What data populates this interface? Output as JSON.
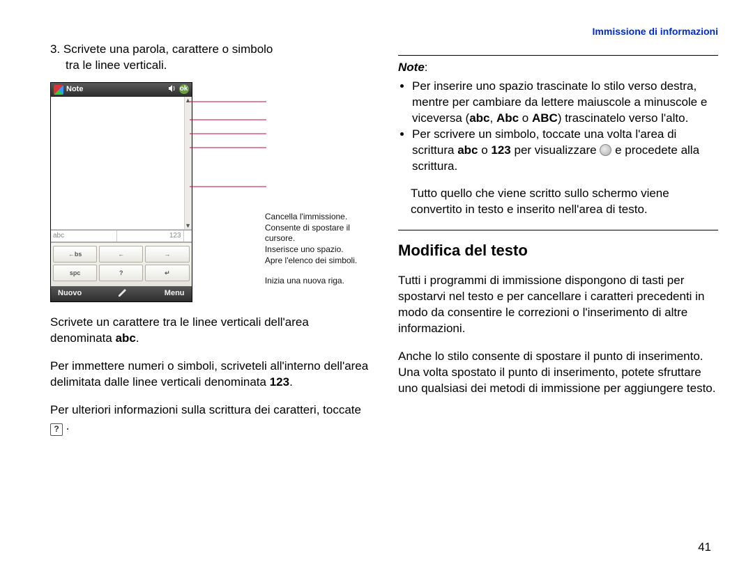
{
  "header": {
    "section_label": "Immissione di informazioni"
  },
  "screenshot": {
    "app_title": "Note",
    "ok_label": "ok",
    "strip_abc": "abc",
    "strip_123": "123",
    "buttons": {
      "bs": "←bs",
      "left": "←",
      "right": "→",
      "spc": "spc",
      "q": "?",
      "enter": "↵"
    },
    "bottom_left": "Nuovo",
    "bottom_right": "Menu"
  },
  "callouts": {
    "c1": "Cancella l'immissione.",
    "c2": "Consente di spostare il cursore.",
    "c3": "Inserisce uno spazio.",
    "c4": "Apre l'elenco dei simboli.",
    "c5": "Inizia una nuova riga."
  },
  "left": {
    "step3_a": "3. Scrivete una parola, carattere o simbolo",
    "step3_b": "tra le linee verticali.",
    "p1_a": "Scrivete un carattere tra le linee verticali dell'area denominata ",
    "p1_b": "abc",
    "p1_c": ".",
    "p2_a": "Per immettere numeri o simboli, scriveteli all'interno dell'area delimitata dalle linee verticali denominata ",
    "p2_b": "123",
    "p2_c": ".",
    "p3_a": "Per ulteriori informazioni sulla scrittura dei caratteri, toccate ",
    "p3_b": " ."
  },
  "right": {
    "note_label": "Note",
    "colon": ":",
    "li1_a": "Per inserire uno spazio trascinate lo stilo verso destra, mentre per cambiare da lettere maiuscole a minuscole e viceversa (",
    "li1_b": "abc",
    "li1_c": ", ",
    "li1_d": "Abc",
    "li1_e": " o ",
    "li1_f": "ABC",
    "li1_g": ") trascinatelo verso l'alto.",
    "li2_a": "Per scrivere un simbolo, toccate una volta l'area di scrittura ",
    "li2_b": "abc",
    "li2_c": " o ",
    "li2_d": "123",
    "li2_e": " per visualizzare ",
    "li2_f": " e procedete alla scrittura.",
    "after_note": "Tutto quello che viene scritto sullo schermo viene convertito in testo e inserito nell'area di testo.",
    "heading": "Modifica del testo",
    "h_p1": "Tutti i programmi di immissione dispongono di tasti per spostarvi nel testo e per cancellare i caratteri precedenti in modo da consentire le correzioni o l'inserimento di altre informazioni.",
    "h_p2": "Anche lo stilo consente di spostare il punto di inserimento. Una volta spostato il punto di inserimento, potete sfruttare uno qualsiasi dei metodi di immissione per aggiungere testo."
  },
  "page_number": "41"
}
